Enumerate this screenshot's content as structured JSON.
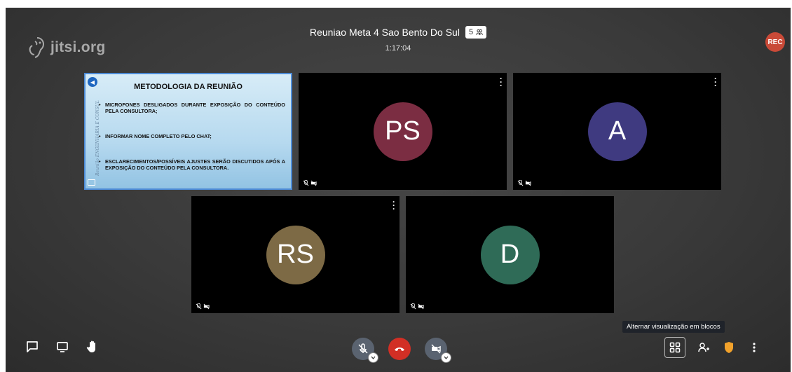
{
  "app": {
    "logo_text": "jitsi.org"
  },
  "meeting": {
    "title": "Reuniao Meta 4 Sao Bento Do Sul",
    "participant_count": "5",
    "timer": "1:17:04",
    "rec_label": "REC"
  },
  "slide": {
    "title": "METODOLOGIA DA REUNIÃO",
    "bullets": [
      "MICROFONES DESLIGADOS DURANTE EXPOSIÇÃO DO CONTEÚDO PELA CONSULTORA;",
      "INFORMAR NOME COMPLETO PELO CHAT;",
      "ESCLARECIMENTOS/POSSÍVEIS AJUSTES SERÃO DISCUTIDOS APÓS A EXPOSIÇÃO DO CONTEÚDO PELA CONSULTORA."
    ],
    "side_text": "Reunião ENGENHARIA E CONSUL"
  },
  "participants": [
    {
      "initials": "PS",
      "color": "#7b2d42"
    },
    {
      "initials": "A",
      "color": "#3f3a80"
    },
    {
      "initials": "RS",
      "color": "#7d6a45"
    },
    {
      "initials": "D",
      "color": "#2f6b57"
    }
  ],
  "toolbar": {
    "tooltip": "Alternar visualização em blocos"
  },
  "colors": {
    "hangup": "#d22f25",
    "security": "#f2a22b",
    "rec": "#c94a38"
  }
}
